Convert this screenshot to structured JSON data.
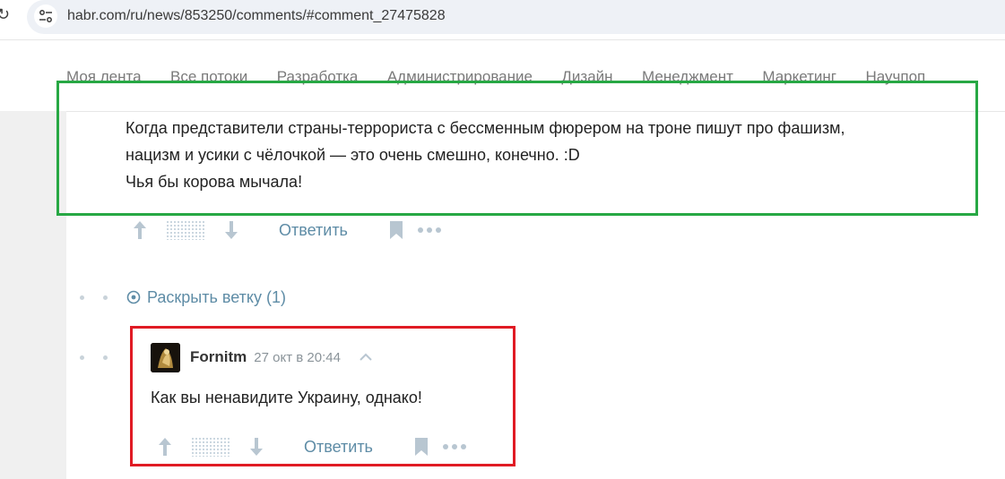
{
  "browser": {
    "url": "habr.com/ru/news/853250/comments/#comment_27475828"
  },
  "nav": {
    "items": [
      "Моя лента",
      "Все потоки",
      "Разработка",
      "Администрирование",
      "Дизайн",
      "Менеджмент",
      "Маркетинг",
      "Научпоп"
    ]
  },
  "comment": {
    "lines": [
      "Когда представители страны-террориста с бессменным фюрером на троне пишут про фашизм,",
      "нацизм и усики с чёлочкой — это очень смешно, конечно. :D",
      "Чья бы корова мычала!"
    ],
    "reply_label": "Ответить"
  },
  "thread": {
    "expand_label": "Раскрыть ветку (1)"
  },
  "reply": {
    "username": "Fornitm",
    "timestamp": "27 окт в 20:44",
    "text": "Как вы ненавидите Украину, однако!",
    "reply_label": "Ответить"
  },
  "colors": {
    "link": "#5e8ca6",
    "highlight_green": "#27a844",
    "highlight_red": "#e01b24"
  }
}
